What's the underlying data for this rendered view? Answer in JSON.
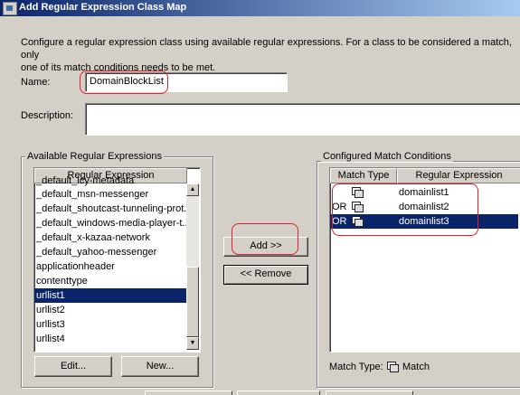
{
  "window": {
    "title": "Add Regular Expression Class Map"
  },
  "intro": "Configure a regular expression class using available regular expressions. For a class to be considered a match, only one of its match conditions needs to be met.",
  "intro_line1": "Configure a regular expression class using available regular expressions. For a class to be considered a match, only",
  "intro_line2": "one of its match conditions needs to be met.",
  "name": {
    "label": "Name:",
    "value": "DomainBlockList"
  },
  "description": {
    "label": "Description:",
    "value": ""
  },
  "available": {
    "group_label": "Available Regular Expressions",
    "column": "Regular Expression",
    "items": [
      "_default_icy-metadata",
      "_default_msn-messenger",
      "_default_shoutcast-tunneling-prot...",
      "_default_windows-media-player-t...",
      "_default_x-kazaa-network",
      "_default_yahoo-messenger",
      "applicationheader",
      "contenttype",
      "urllist1",
      "urllist2",
      "urllist3",
      "urllist4"
    ],
    "selected_index": 8,
    "edit_label": "Edit...",
    "new_label": "New..."
  },
  "buttons": {
    "add": "Add >>",
    "remove": "<< Remove"
  },
  "configured": {
    "group_label": "Configured Match Conditions",
    "col_match_type": "Match Type",
    "col_regex": "Regular Expression",
    "rows": [
      {
        "op": "",
        "regex": "domainlist1"
      },
      {
        "op": "OR",
        "regex": "domainlist2"
      },
      {
        "op": "OR",
        "regex": "domainlist3"
      }
    ],
    "selected_index": 2,
    "footer_label": "Match Type:",
    "footer_value": "Match"
  }
}
